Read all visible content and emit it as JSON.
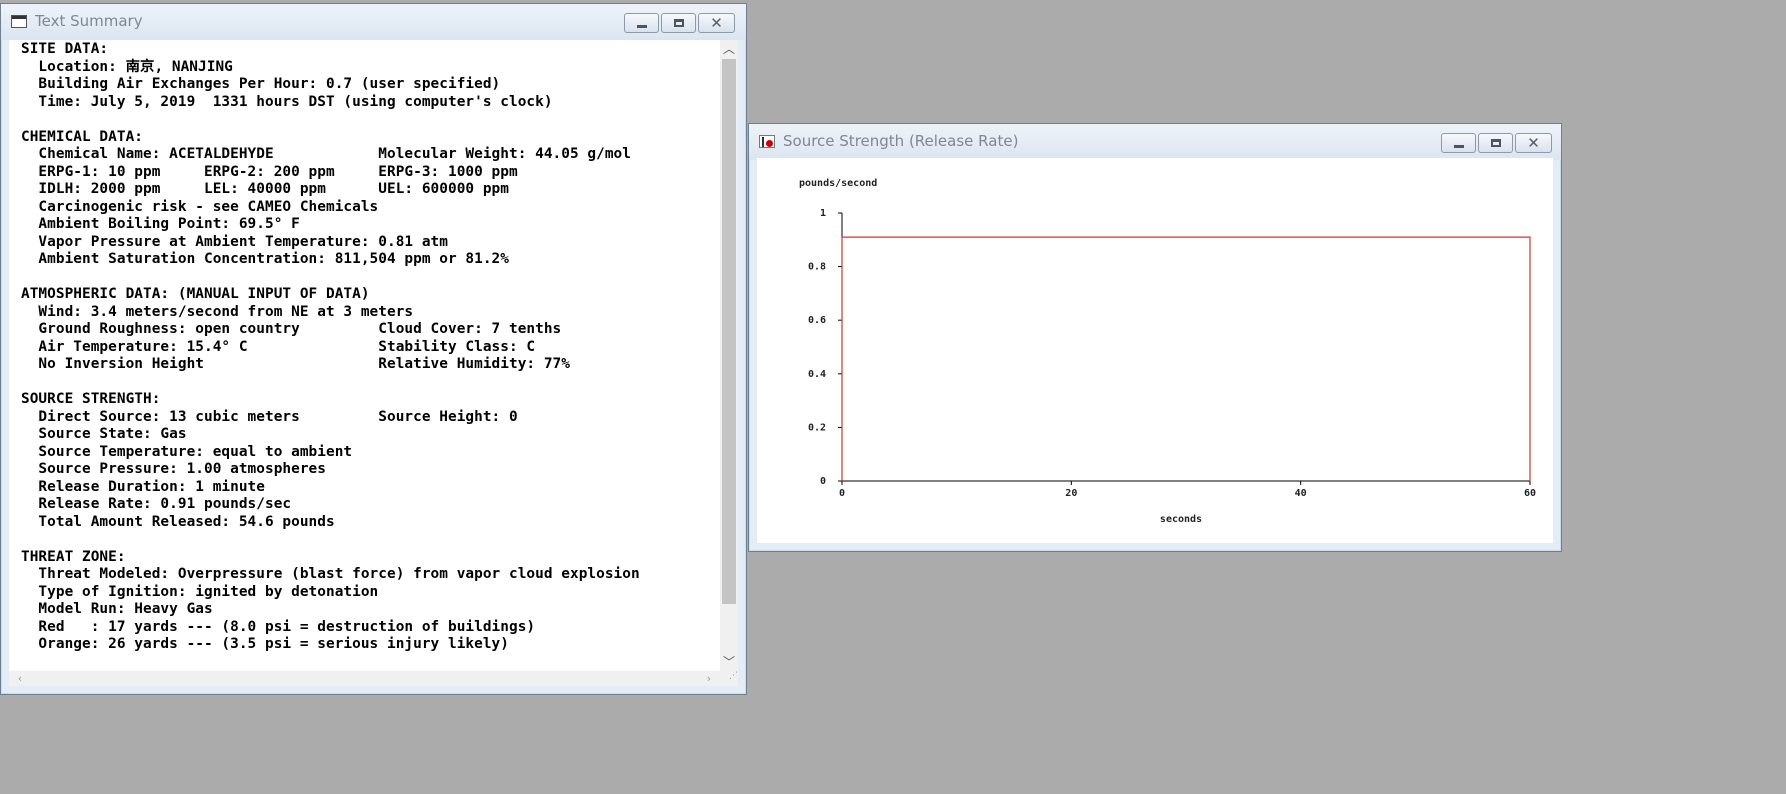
{
  "text_window": {
    "title": "Text Summary",
    "lines": [
      "SITE DATA:",
      "  Location: 南京, NANJING",
      "  Building Air Exchanges Per Hour: 0.7 (user specified)",
      "  Time: July 5, 2019  1331 hours DST (using computer's clock)",
      "",
      "CHEMICAL DATA:",
      "  Chemical Name: ACETALDEHYDE            Molecular Weight: 44.05 g/mol",
      "  ERPG-1: 10 ppm     ERPG-2: 200 ppm     ERPG-3: 1000 ppm",
      "  IDLH: 2000 ppm     LEL: 40000 ppm      UEL: 600000 ppm",
      "  Carcinogenic risk - see CAMEO Chemicals",
      "  Ambient Boiling Point: 69.5° F",
      "  Vapor Pressure at Ambient Temperature: 0.81 atm",
      "  Ambient Saturation Concentration: 811,504 ppm or 81.2%",
      "",
      "ATMOSPHERIC DATA: (MANUAL INPUT OF DATA)",
      "  Wind: 3.4 meters/second from NE at 3 meters",
      "  Ground Roughness: open country         Cloud Cover: 7 tenths",
      "  Air Temperature: 15.4° C               Stability Class: C",
      "  No Inversion Height                    Relative Humidity: 77%",
      "",
      "SOURCE STRENGTH:",
      "  Direct Source: 13 cubic meters         Source Height: 0",
      "  Source State: Gas",
      "  Source Temperature: equal to ambient",
      "  Source Pressure: 1.00 atmospheres",
      "  Release Duration: 1 minute",
      "  Release Rate: 0.91 pounds/sec",
      "  Total Amount Released: 54.6 pounds",
      "",
      "THREAT ZONE:",
      "  Threat Modeled: Overpressure (blast force) from vapor cloud explosion",
      "  Type of Ignition: ignited by detonation",
      "  Model Run: Heavy Gas",
      "  Red   : 17 yards --- (8.0 psi = destruction of buildings)",
      "  Orange: 26 yards --- (3.5 psi = serious injury likely)"
    ]
  },
  "chart_window": {
    "title": "Source Strength (Release Rate)"
  },
  "chart_data": {
    "type": "line",
    "title": "",
    "xlabel": "seconds",
    "ylabel": "pounds/second",
    "xlim": [
      0,
      60
    ],
    "ylim": [
      0,
      1
    ],
    "xticks": [
      0,
      20,
      40,
      60
    ],
    "yticks": [
      0,
      0.2,
      0.4,
      0.6,
      0.8,
      1
    ],
    "series": [
      {
        "color": "#e03030",
        "x": [
          0,
          0,
          60,
          60
        ],
        "y": [
          0,
          0.91,
          0.91,
          0
        ]
      }
    ],
    "grid": false,
    "legend": "none"
  }
}
